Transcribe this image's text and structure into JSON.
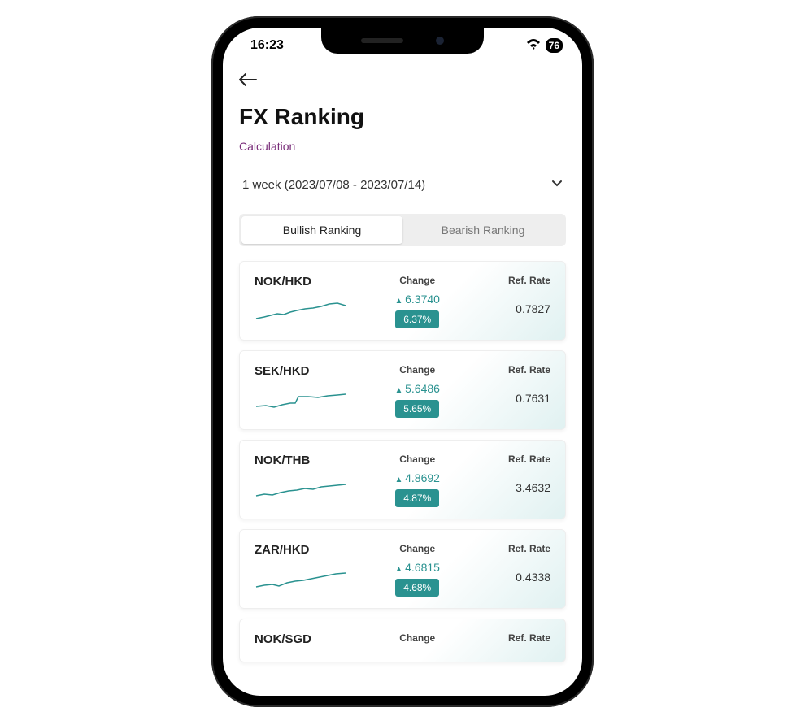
{
  "status": {
    "time": "16:23",
    "battery": "76"
  },
  "page": {
    "title": "FX Ranking",
    "calc_link": "Calculation",
    "period_label": "1 week (2023/07/08 - 2023/07/14)"
  },
  "tabs": {
    "bullish": "Bullish Ranking",
    "bearish": "Bearish Ranking"
  },
  "labels": {
    "change": "Change",
    "ref_rate": "Ref. Rate"
  },
  "items": [
    {
      "pair": "NOK/HKD",
      "change": "6.3740",
      "pct": "6.37%",
      "rate": "0.7827"
    },
    {
      "pair": "SEK/HKD",
      "change": "5.6486",
      "pct": "5.65%",
      "rate": "0.7631"
    },
    {
      "pair": "NOK/THB",
      "change": "4.8692",
      "pct": "4.87%",
      "rate": "3.4632"
    },
    {
      "pair": "ZAR/HKD",
      "change": "4.6815",
      "pct": "4.68%",
      "rate": "0.4338"
    },
    {
      "pair": "NOK/SGD",
      "change": "",
      "pct": "",
      "rate": ""
    }
  ]
}
